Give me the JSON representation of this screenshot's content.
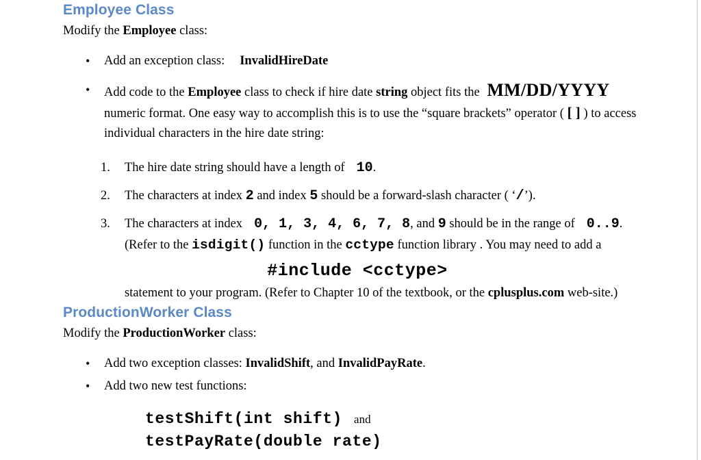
{
  "document": {
    "heading_color": "#5B88C8",
    "background": "#FFFFFF"
  },
  "sections": [
    {
      "heading": "Employee Class",
      "lead_prefix": "Modify the ",
      "lead_bold": "Employee",
      "lead_suffix": " class:",
      "bullets": [
        {
          "bullet_glyph": "•",
          "text_1": "Add an exception class:",
          "code_1": "InvalidHireDate"
        },
        {
          "bullet_glyph": "•",
          "text_1": "Add code to the ",
          "bold_1": "Employee",
          "text_2": " class to check if hire date ",
          "bold_2": "string",
          "text_3": " object fits the ",
          "format_code": "MM/DD/YYYY",
          "text_4": "numeric format.  One easy way to accomplish this is to use the “square brackets” operator ( ",
          "bracket_code": "[   ]",
          "text_5": " ) to access individual characters in the hire date string:"
        }
      ],
      "numbered": [
        {
          "marker": "1.",
          "text_1": "The hire date string should have a length of",
          "value": "10",
          "text_2": "."
        },
        {
          "marker": "2.",
          "text_1": "The characters at index ",
          "value_1": "2",
          "text_2": " and index ",
          "value_2": "5",
          "text_3": " should be a forward-slash character ( ‘",
          "slash": "/",
          "text_4": "’)."
        },
        {
          "marker": "3.",
          "text_1": "The characters at index",
          "indices": [
            "0",
            "1",
            "3",
            "4",
            "6",
            "7",
            "8"
          ],
          "text_2": ", and ",
          "last_index": "9",
          "text_3": " should be in the range of",
          "range": "0..9",
          "text_4": ".  (Refer to the ",
          "func_name": "isdigit()",
          "text_5": " function in the ",
          "lib_name": "cctype",
          "text_6": " function library .   You may need to add a"
        }
      ],
      "code_block": "#include <cctype>",
      "closing": {
        "text_1": "statement to your program.  (Refer to Chapter 10 of the textbook, or the ",
        "bold_1": "cplusplus.com",
        "text_2": " web-site.)"
      }
    },
    {
      "heading": "ProductionWorker Class",
      "lead_prefix": "Modify the ",
      "lead_bold": "ProductionWorker",
      "lead_suffix": " class:",
      "bullets": [
        {
          "bullet_glyph": "•",
          "text_1": "Add two exception classes:  ",
          "bold_1": "InvalidShift",
          "text_2": ", and ",
          "bold_2": "InvalidPayRate",
          "text_3": "."
        },
        {
          "bullet_glyph": "•",
          "text_1": "Add two new test functions:"
        }
      ],
      "functions": [
        {
          "signature": "testShift(int shift)",
          "trailing": "and"
        },
        {
          "signature": "testPayRate(double rate)",
          "trailing": ""
        }
      ]
    }
  ]
}
